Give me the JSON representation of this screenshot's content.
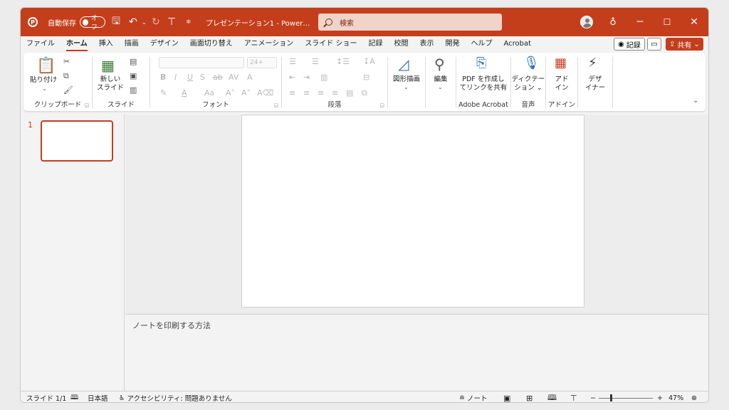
{
  "titlebar": {
    "logo": "P",
    "autosave_label": "自動保存",
    "autosave_state": "オフ",
    "filename": "プレゼンテーション1 - Power…",
    "search_placeholder": "検索",
    "min": "─",
    "max": "☐",
    "close": "✕"
  },
  "tabs": [
    "ファイル",
    "ホーム",
    "挿入",
    "描画",
    "デザイン",
    "画面切り替え",
    "アニメーション",
    "スライド ショー",
    "記録",
    "校閲",
    "表示",
    "開発",
    "ヘルプ",
    "Acrobat"
  ],
  "active_tab": "ホーム",
  "actions": {
    "record": "記録",
    "share": "共有"
  },
  "ribbon": {
    "clipboard": {
      "paste": "貼り付け",
      "label": "クリップボード"
    },
    "slides": {
      "new_slide_1": "新しい",
      "new_slide_2": "スライド",
      "label": "スライド"
    },
    "font": {
      "size": "24+",
      "label": "フォント"
    },
    "paragraph": {
      "label": "段落"
    },
    "drawing": {
      "shapes": "図形描画"
    },
    "editing": {
      "edit": "編集"
    },
    "acrobat": {
      "pdf_1": "PDF を作成し",
      "pdf_2": "てリンクを共有",
      "label": "Adobe Acrobat"
    },
    "voice": {
      "dictate_1": "ディクテー",
      "dictate_2": "ション",
      "label": "音声"
    },
    "addins": {
      "btn_1": "アド",
      "btn_2": "イン",
      "label": "アドイン"
    },
    "designer": {
      "btn_1": "デザ",
      "btn_2": "イナー"
    }
  },
  "thumbnails": {
    "slide_number": "1"
  },
  "notes": {
    "placeholder": "ノートを印刷する方法"
  },
  "statusbar": {
    "slide": "スライド 1/1",
    "language": "日本語",
    "accessibility": "アクセシビリティ: 問題ありません",
    "notes": "ノート",
    "zoom": "47%"
  },
  "colors": {
    "accent": "#c43e1c"
  }
}
